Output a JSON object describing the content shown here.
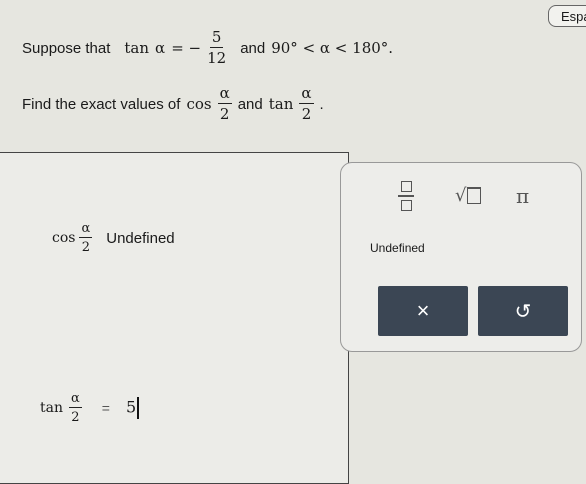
{
  "lang_button": {
    "label": "Espa"
  },
  "problem": {
    "line1_prefix": "Suppose that",
    "tan": "tan",
    "alpha": "α",
    "eq": "= −",
    "frac_num": "5",
    "frac_den": "12",
    "and": "and",
    "range": "90° < α < 180°.",
    "line2_prefix": "Find the exact values of",
    "cos": "cos",
    "half_num": "α",
    "half_den": "2",
    "and2": "and",
    "period": "."
  },
  "answers": {
    "cos_label": "cos",
    "cos_num": "α",
    "cos_den": "2",
    "cos_value": "Undefined",
    "tan_label": "tan",
    "tan_num": "α",
    "tan_den": "2",
    "tan_eq": "=",
    "tan_value": "5"
  },
  "keypad": {
    "pi": "π",
    "undefined": "Undefined",
    "clear": "×",
    "undo": "↺"
  }
}
